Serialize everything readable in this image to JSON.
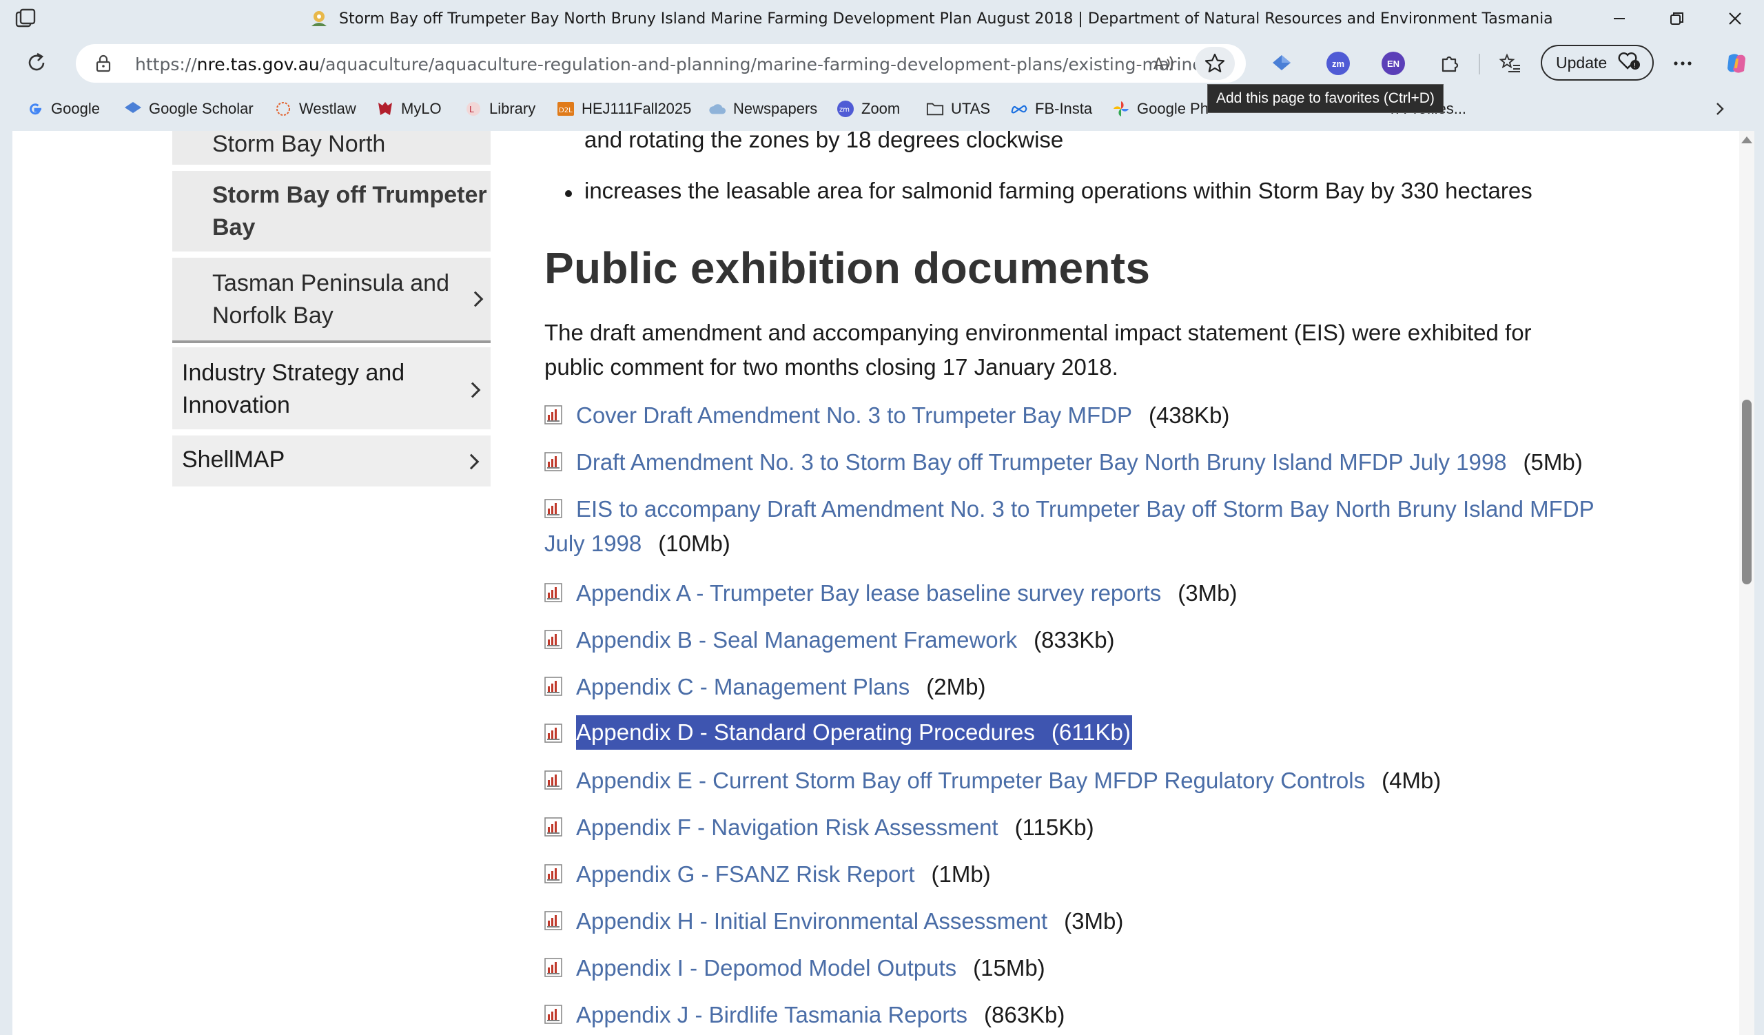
{
  "browser": {
    "window_title": "Storm Bay off Trumpeter Bay North Bruny Island Marine Farming Development Plan August 2018 | Department of Natural Resources and Environment Tasmania",
    "url_prefix": "https://",
    "url_host": "nre.tas.gov.au",
    "url_path": "/aquaculture/aquaculture-regulation-and-planning/marine-farming-development-plans/existing-marine-...",
    "update_label": "Update",
    "tooltip": "Add this page to favorites (Ctrl+D)",
    "extensions": [
      {
        "name": "scholar-extension",
        "label": ""
      },
      {
        "name": "zoom-extension",
        "label": "zm"
      },
      {
        "name": "language-extension",
        "label": "EN"
      }
    ],
    "favorites": [
      {
        "label": "Google",
        "icon": "google-icon"
      },
      {
        "label": "Google Scholar",
        "icon": "scholar-icon"
      },
      {
        "label": "Westlaw",
        "icon": "westlaw-icon"
      },
      {
        "label": "MyLO",
        "icon": "mylo-icon"
      },
      {
        "label": "Library",
        "icon": "library-icon"
      },
      {
        "label": "HEJ111Fall2025",
        "icon": "d2l-icon"
      },
      {
        "label": "Newspapers",
        "icon": "cloud-icon"
      },
      {
        "label": "Zoom",
        "icon": "zoom-icon"
      },
      {
        "label": "UTAS",
        "icon": "folder-icon"
      },
      {
        "label": "FB-Insta",
        "icon": "meta-icon"
      },
      {
        "label": "Google Ph",
        "icon": "photos-icon"
      },
      {
        "label": "n Profiles...",
        "icon": ""
      }
    ],
    "colors": {
      "chrome_bg": "#e3eaf0",
      "link": "#4a6da7",
      "selection": "#3e55b0"
    }
  },
  "sidebar": {
    "sub_items": [
      {
        "label_lines": [
          "Storm Bay North"
        ],
        "active": false,
        "has_chevron": false
      },
      {
        "label_lines": [
          "Storm Bay off Trumpeter",
          "Bay"
        ],
        "active": true,
        "has_chevron": false
      },
      {
        "label_lines": [
          "Tasman Peninsula and",
          "Norfolk Bay"
        ],
        "active": false,
        "has_chevron": true
      }
    ],
    "main_items": [
      {
        "label_lines": [
          "Industry Strategy and",
          "Innovation"
        ],
        "has_chevron": true
      },
      {
        "label_lines": [
          "ShellMAP"
        ],
        "has_chevron": true
      }
    ]
  },
  "content": {
    "partial_line": "and rotating the zones by 18 degrees clockwise",
    "bullet_text": "increases the leasable area for salmonid farming operations within Storm Bay by 330 hectares",
    "heading": "Public exhibition documents",
    "intro_lines": [
      "The draft amendment and accompanying environmental impact statement (EIS) were exhibited for",
      "public comment for two months closing 17 January 2018."
    ],
    "documents": [
      {
        "title": "Cover Draft Amendment No. 3 to Trumpeter Bay MFDP",
        "size": "(438Kb)"
      },
      {
        "title": "Draft Amendment No. 3 to Storm Bay off Trumpeter Bay North Bruny Island MFDP July 1998",
        "size": "(5Mb)"
      },
      {
        "title_line1": "EIS to accompany Draft Amendment No. 3 to Trumpeter Bay off Storm Bay North Bruny Island MFDP",
        "title_line2": "July 1998",
        "size": "(10Mb)"
      },
      {
        "title": "Appendix A - Trumpeter Bay lease baseline survey reports",
        "size": "(3Mb)"
      },
      {
        "title": "Appendix B - Seal Management Framework",
        "size": "(833Kb)"
      },
      {
        "title": "Appendix C - Management Plans",
        "size": "(2Mb)"
      },
      {
        "title": "Appendix D - Standard Operating Procedures",
        "size": "(611Kb)",
        "selected": true
      },
      {
        "title": "Appendix E - Current Storm Bay off Trumpeter Bay MFDP Regulatory Controls",
        "size": "(4Mb)"
      },
      {
        "title": "Appendix F - Navigation Risk Assessment",
        "size": "(115Kb)"
      },
      {
        "title": "Appendix G - FSANZ Risk Report",
        "size": "(1Mb)"
      },
      {
        "title": "Appendix H - Initial Environmental Assessment",
        "size": "(3Mb)"
      },
      {
        "title": "Appendix I - Depomod Model Outputs",
        "size": "(15Mb)"
      },
      {
        "title": "Appendix J - Birdlife Tasmania Reports",
        "size": "(863Kb)"
      }
    ]
  }
}
